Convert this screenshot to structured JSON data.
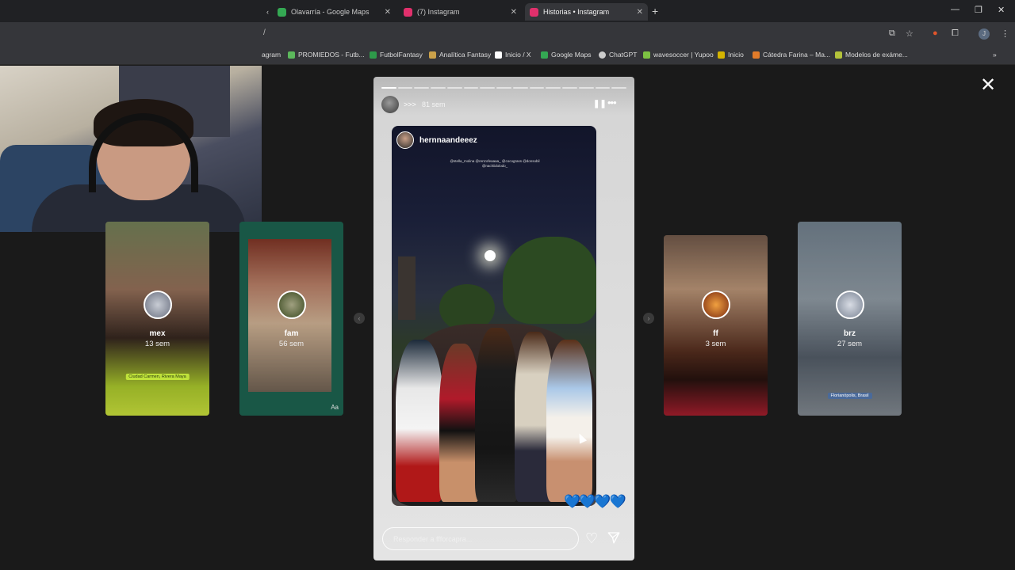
{
  "browser": {
    "tabs": [
      {
        "label": "Olavarría - Google Maps",
        "icon": "maps-pin-icon",
        "color": "#34a853"
      },
      {
        "label": "(7) Instagram",
        "icon": "instagram-icon",
        "color": "#e1306c"
      },
      {
        "label": "Historias • Instagram",
        "icon": "instagram-icon",
        "color": "#e1306c",
        "active": true
      }
    ],
    "address_fragment": "/",
    "bookmarks": [
      {
        "label": "agram",
        "color": "#e1306c"
      },
      {
        "label": "PROMIEDOS - Futb...",
        "color": "#5cb85c"
      },
      {
        "label": "FutbolFantasy",
        "color": "#2e9a4a"
      },
      {
        "label": "Analítica Fantasy",
        "color": "#caa14a"
      },
      {
        "label": "Inicio / X",
        "color": "#ffffff"
      },
      {
        "label": "Google Maps",
        "color": "#34a853"
      },
      {
        "label": "ChatGPT",
        "color": "#cccccc"
      },
      {
        "label": "wavesoccer | Yupoo",
        "color": "#7cc242"
      },
      {
        "label": "Inicio",
        "color": "#d4b400"
      },
      {
        "label": "Cátedra Farina – Ma...",
        "color": "#e07b2a"
      },
      {
        "label": "Modelos de exáme...",
        "color": "#b3c23a"
      }
    ]
  },
  "stories": {
    "side_cards": [
      {
        "name": "mex",
        "time": "13 sem",
        "tag": "Ciudad Carmen, Rivera Maya"
      },
      {
        "name": "fam",
        "time": "56 sem",
        "tag": "Aa"
      },
      {
        "name": "ff",
        "time": "3 sem",
        "tag": ""
      },
      {
        "name": "brz",
        "time": "27 sem",
        "tag": "Florianópolis, Brasil"
      }
    ],
    "current": {
      "user": ">>>",
      "time": "81 sem",
      "progress_segments": 15,
      "progress_active": 1,
      "post_user": "hernnaandeeez",
      "caption": "@stella_molina @renzofeaaaa_ @cocograss @donsobil @nachiidolodo_",
      "emoji": "💙💙💙💙",
      "reply_placeholder": "Responder a ffforcapra..."
    }
  },
  "colors": {
    "accent": "#1d5ed8",
    "background": "#1a1a1a"
  }
}
